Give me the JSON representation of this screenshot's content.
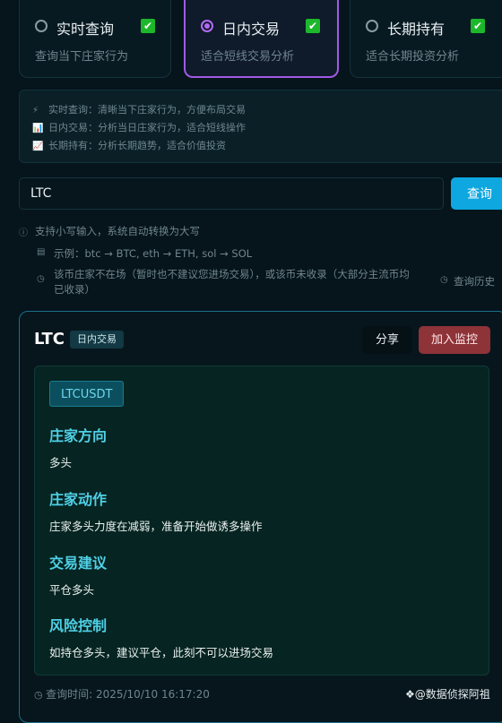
{
  "modes": [
    {
      "title": "实时查询",
      "desc": "查询当下庄家行为",
      "selected": false
    },
    {
      "title": "日内交易",
      "desc": "适合短线交易分析",
      "selected": true
    },
    {
      "title": "长期持有",
      "desc": "适合长期投资分析",
      "selected": false
    }
  ],
  "info": [
    {
      "icon": "⚡",
      "text": "实时查询：清晰当下庄家行为，方便布局交易"
    },
    {
      "icon": "📊",
      "text": "日内交易：分析当日庄家行为，适合短线操作"
    },
    {
      "icon": "📈",
      "text": "长期持有：分析长期趋势，适合价值投资"
    }
  ],
  "search": {
    "value": "LTC",
    "button": "查询"
  },
  "hints": {
    "uppercase": "支持小写输入，系统自动转换为大写",
    "example": "示例：btc → BTC, eth → ETH, sol → SOL",
    "notice_line1": "该币庄家不在场（暂时也不建议您进场交易），或该币未收录（大部分主流币均",
    "notice_line2": "已收录）",
    "history": "查询历史"
  },
  "result": {
    "coin": "LTC",
    "mode_badge": "日内交易",
    "share": "分享",
    "add_monitor": "加入监控",
    "pair": "LTCUSDT",
    "sections": [
      {
        "title": "庄家方向",
        "body": "多头"
      },
      {
        "title": "庄家动作",
        "body": "庄家多头力度在减弱，准备开始做诱多操作"
      },
      {
        "title": "交易建议",
        "body": "平仓多头"
      },
      {
        "title": "风险控制",
        "body": "如持仓多头，建议平仓，此刻不可以进场交易"
      }
    ],
    "query_time": "查询时间: 2025/10/10 16:17:20",
    "brand": "@数据侦探阿祖"
  }
}
